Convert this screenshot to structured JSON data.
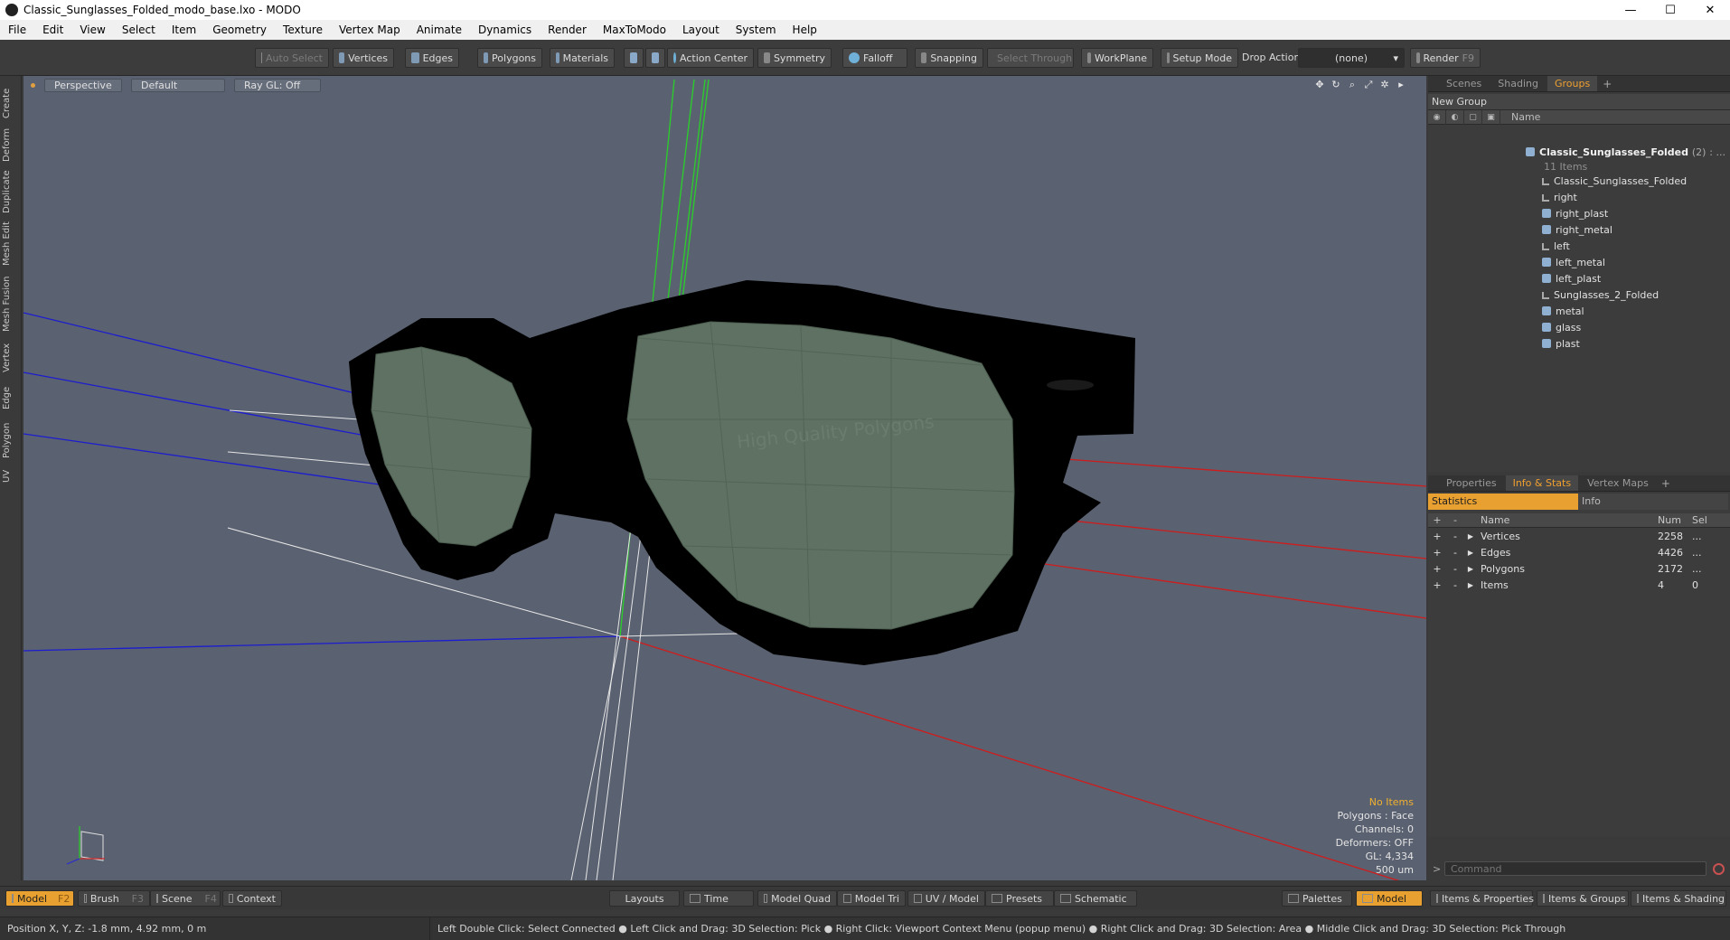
{
  "window": {
    "title": "Classic_Sunglasses_Folded_modo_base.lxo - MODO",
    "minimize": "—",
    "maximize": "☐",
    "close": "✕"
  },
  "menu": [
    "File",
    "Edit",
    "View",
    "Select",
    "Item",
    "Geometry",
    "Texture",
    "Vertex Map",
    "Animate",
    "Dynamics",
    "Render",
    "MaxToModo",
    "Layout",
    "System",
    "Help"
  ],
  "toolbar": {
    "auto_select": "Auto Select",
    "vertices": "Vertices",
    "edges": "Edges",
    "polygons": "Polygons",
    "materials": "Materials",
    "action_center": "Action Center",
    "symmetry": "Symmetry",
    "falloff": "Falloff",
    "snapping": "Snapping",
    "select_through": "Select Through",
    "workplane": "WorkPlane",
    "setup_mode": "Setup Mode",
    "drop_action": "Drop Action",
    "drop_value": "(none)",
    "render": "Render",
    "render_key": "F9"
  },
  "left_tabs": [
    "Create",
    "Deform",
    "Duplicate",
    "Mesh Edit",
    "Mesh Fusion",
    "Vertex",
    "Edge",
    "Polygon",
    "UV"
  ],
  "viewport": {
    "view": "Perspective",
    "style": "Default",
    "raygl": "Ray GL: Off",
    "watermark": "High Quality Polygons",
    "stats": {
      "no_items": "No Items",
      "polygons": "Polygons : Face",
      "channels": "Channels: 0",
      "deformers": "Deformers: OFF",
      "gl": "GL: 4,334",
      "scale": "500 um"
    },
    "colors": {
      "background": "#5a6170",
      "lens": "#5e7162",
      "frame": "#000000"
    }
  },
  "groups_panel": {
    "tabs": [
      "Scenes",
      "Shading",
      "Groups"
    ],
    "active_tab": "Groups",
    "new_group": "New Group",
    "column_name": "Name",
    "root": {
      "label": "Classic_Sunglasses_Folded",
      "count": "(2)",
      "more": ": ...",
      "sub": "11 Items"
    },
    "items": [
      {
        "label": "Classic_Sunglasses_Folded",
        "type": "locator"
      },
      {
        "label": "right",
        "type": "locator"
      },
      {
        "label": "right_plast",
        "type": "mesh"
      },
      {
        "label": "right_metal",
        "type": "mesh"
      },
      {
        "label": "left",
        "type": "locator"
      },
      {
        "label": "left_metal",
        "type": "mesh"
      },
      {
        "label": "left_plast",
        "type": "mesh"
      },
      {
        "label": "Sunglasses_2_Folded",
        "type": "locator"
      },
      {
        "label": "metal",
        "type": "mesh"
      },
      {
        "label": "glass",
        "type": "mesh"
      },
      {
        "label": "plast",
        "type": "mesh"
      }
    ]
  },
  "info_panel": {
    "tabs": [
      "Properties",
      "Info & Stats",
      "Vertex Maps"
    ],
    "active_tab": "Info & Stats",
    "subtabs": [
      "Statistics",
      "Info"
    ],
    "columns": {
      "plus": "+",
      "minus": "-",
      "name": "Name",
      "num": "Num",
      "sel": "Sel"
    },
    "rows": [
      {
        "name": "Vertices",
        "num": "2258",
        "sel": "..."
      },
      {
        "name": "Edges",
        "num": "4426",
        "sel": "..."
      },
      {
        "name": "Polygons",
        "num": "2172",
        "sel": "..."
      },
      {
        "name": "Items",
        "num": "4",
        "sel": "0"
      }
    ]
  },
  "command": {
    "placeholder": "Command",
    "prompt": ">"
  },
  "bottom_bar": {
    "model": "Model",
    "model_key": "F2",
    "brush": "Brush",
    "brush_key": "F3",
    "scene": "Scene",
    "scene_key": "F4",
    "context": "Context",
    "layouts": "Layouts",
    "time": "Time",
    "model_quad": "Model Quad",
    "model_tri": "Model Tri",
    "uv_model": "UV / Model",
    "presets": "Presets",
    "schematic": "Schematic",
    "palettes": "Palettes",
    "model_right": "Model",
    "items_props": "Items & Properties",
    "items_groups": "Items & Groups",
    "items_shading": "Items & Shading"
  },
  "status": {
    "position": "Position X, Y, Z:   -1.8 mm, 4.92 mm, 0 m",
    "hint": "Left Double Click: Select Connected ● Left Click and Drag: 3D Selection: Pick ● Right Click: Viewport Context Menu (popup menu) ● Right Click and Drag: 3D Selection: Area ● Middle Click and Drag: 3D Selection: Pick Through"
  },
  "accent": "#e8a030"
}
